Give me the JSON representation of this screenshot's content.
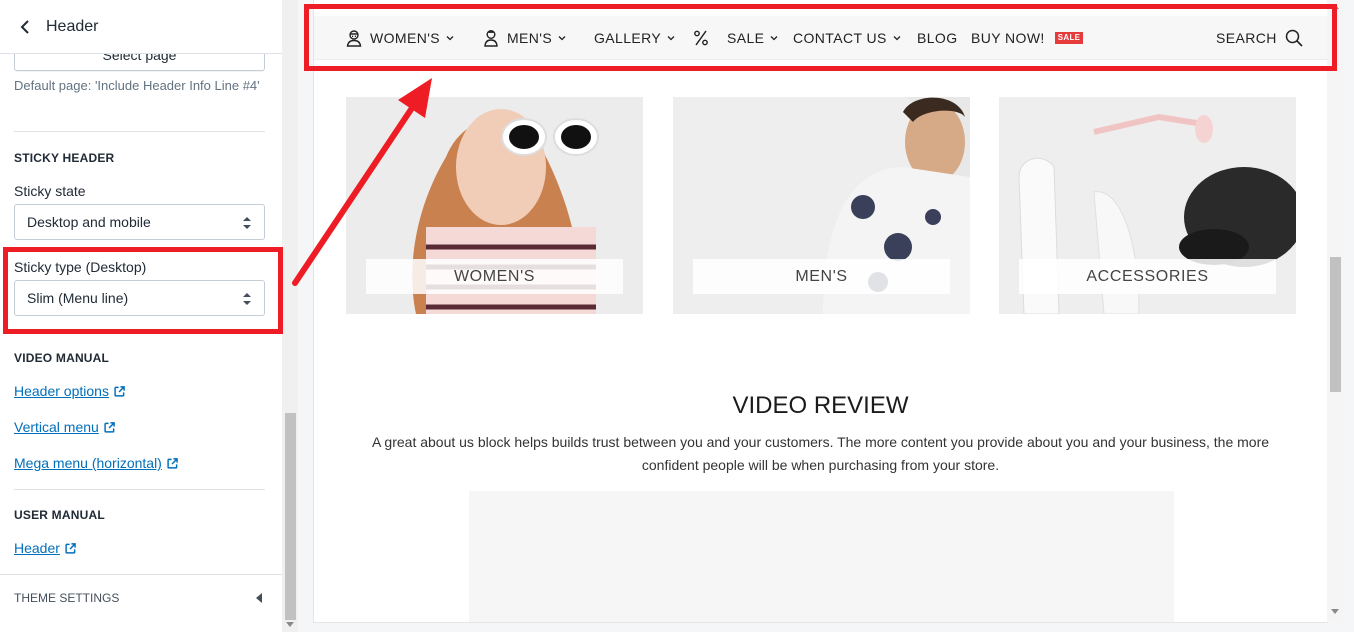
{
  "sidebar": {
    "title": "Header",
    "select_page_label": "Select page",
    "help_text": "Default page: 'Include Header Info Line #4'",
    "sticky_header": {
      "heading": "STICKY HEADER",
      "state_label": "Sticky state",
      "state_value": "Desktop and mobile",
      "type_label": "Sticky type (Desktop)",
      "type_value": "Slim (Menu line)"
    },
    "video_manual": {
      "heading": "VIDEO MANUAL",
      "links": [
        "Header options",
        "Vertical menu",
        "Mega menu (horizontal)"
      ]
    },
    "user_manual": {
      "heading": "USER MANUAL",
      "links": [
        "Header"
      ]
    },
    "theme_settings": "THEME SETTINGS"
  },
  "preview": {
    "nav": {
      "items": [
        {
          "label": "WOMEN'S",
          "icon": "woman-icon",
          "dropdown": true
        },
        {
          "label": "MEN'S",
          "icon": "man-icon",
          "dropdown": true
        },
        {
          "label": "GALLERY",
          "dropdown": true
        },
        {
          "label": "SALE",
          "icon": "percent-icon",
          "dropdown": true
        },
        {
          "label": "CONTACT US",
          "dropdown": true
        },
        {
          "label": "BLOG"
        },
        {
          "label": "BUY NOW!",
          "badge": "SALE"
        }
      ],
      "search_label": "SEARCH"
    },
    "collections": [
      {
        "label": "WOMEN'S"
      },
      {
        "label": "MEN'S"
      },
      {
        "label": "ACCESSORIES"
      }
    ],
    "video_review": {
      "title": "VIDEO REVIEW",
      "text": "A great about us block helps builds trust between you and your customers. The more content you provide about you and your business, the more confident people will be when purchasing from your store."
    }
  },
  "colors": {
    "annotation": "#ee1c24",
    "link": "#006fbb",
    "sale_badge": "#e63b3b"
  }
}
